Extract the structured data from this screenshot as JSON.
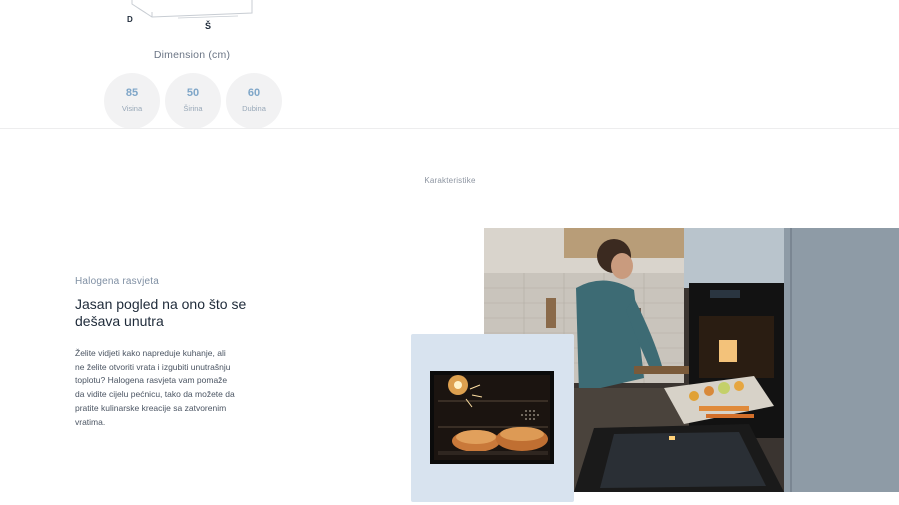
{
  "dimensions": {
    "axis_labels": {
      "depth": "D",
      "width": "Š"
    },
    "title": "Dimension (cm)",
    "items": [
      {
        "value": "85",
        "label": "Visina"
      },
      {
        "value": "50",
        "label": "Širina"
      },
      {
        "value": "60",
        "label": "Dubina"
      }
    ]
  },
  "characteristics": {
    "section_label": "Karakteristike",
    "feature": {
      "eyebrow": "Halogena rasvjeta",
      "title": "Jasan pogled na ono što se dešava unutra",
      "text": "Želite vidjeti kako napreduje kuhanje, ali ne želite otvoriti vrata i izgubiti unutrašnju toplotu? Halogena rasvjeta vam pomaže da vidite cijelu pećnicu, tako da možete da pratite kulinarske kreacije sa zatvorenim vratima."
    }
  },
  "colors": {
    "accent_value": "#7fa6c8",
    "card_background": "#d8e3ef",
    "circle_background": "#f2f2f3"
  }
}
